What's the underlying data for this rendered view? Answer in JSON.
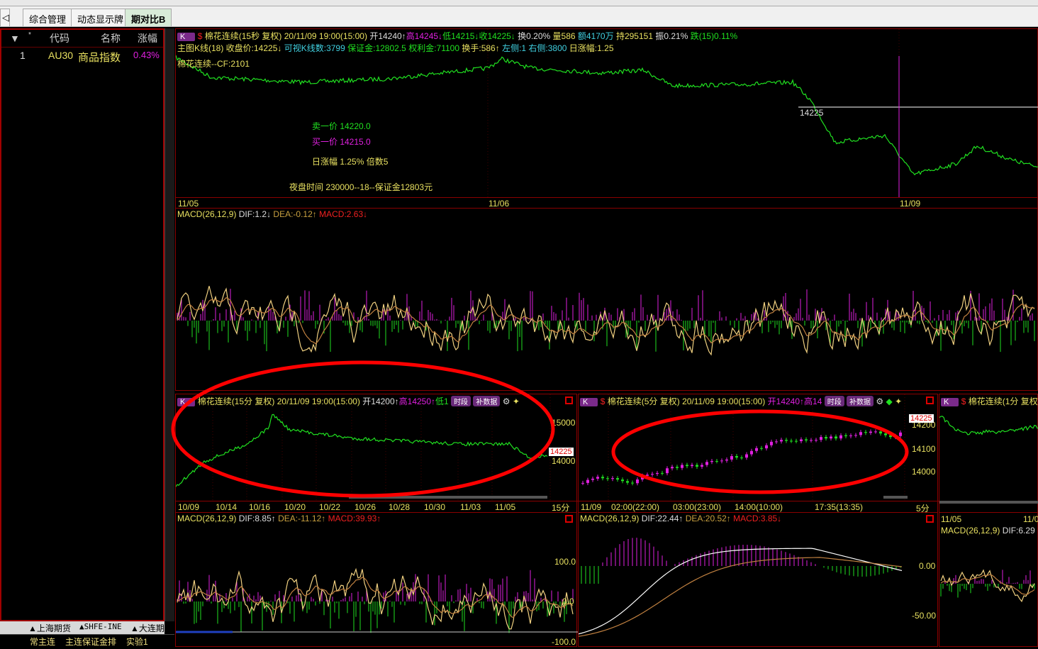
{
  "tabs": [
    "综合管理",
    "动态显示牌",
    "期对比B"
  ],
  "watchlist": {
    "headers": [
      "*",
      "代码",
      "名称",
      "涨幅"
    ],
    "rows": [
      {
        "no": "1",
        "code": "AU30",
        "name": "商品指数",
        "change": "0.43%"
      }
    ]
  },
  "main": {
    "k": "K",
    "title": "棉花连续(15秒 复权)",
    "time": "20/11/09 19:00(15:00)",
    "open": "开14240↑",
    "high": "高14245↓",
    "low": "低14215↓",
    "close": "收14225↓",
    "turn": "换0.20%",
    "vol": "量586",
    "amt": "额4170万",
    "hold": "持295151",
    "amp": "振0.21%",
    "fall": "跌(15)0.11%",
    "line2": {
      "a": "主图K线(18) 收盘价:14225↓",
      "b": "可视K线数:3799",
      "c": "保证金:12802.5",
      "d": "权利金:71100",
      "e": "换手:586↑",
      "f": "左侧:1",
      "g": "右侧:3800",
      "h": "日涨幅:1.25"
    },
    "contract": "棉花连续--CF:2101",
    "sell": "卖一价 14220.0",
    "buy": "买一价 14215.0",
    "daily": "日涨幅  1.25%  倍数5",
    "night": "夜盘时间 230000--18--保证金12803元",
    "cursor_price": "14225",
    "dates": [
      "11/05",
      "11/06",
      "11/09"
    ],
    "macd": {
      "label": "MACD(26,12,9)",
      "dif": "DIF:1.2↓",
      "dea": "DEA:-0.12↑",
      "macd": "MACD:2.63↓"
    }
  },
  "sub1": {
    "k": "K",
    "title": "棉花连续(15分 复权)",
    "time": "20/11/09 19:00(15:00)",
    "open": "开14200↑",
    "high": "高14250↑",
    "low": "低1",
    "btn1": "时段",
    "btn2": "补数据",
    "y": [
      "15000",
      "14000"
    ],
    "price": "14225",
    "dates": [
      "10/09",
      "10/14",
      "10/16",
      "10/20",
      "10/22",
      "10/26",
      "10/28",
      "10/30",
      "11/03",
      "11/05"
    ],
    "period": "15分",
    "macd": {
      "label": "MACD(26,12,9)",
      "dif": "DIF:8.85↑",
      "dea": "DEA:-11.12↑",
      "macd": "MACD:39.93↑",
      "y": [
        "100.0",
        "0.0",
        "-100.0"
      ]
    }
  },
  "sub2": {
    "k": "K",
    "title": "棉花连续(5分 复权)",
    "time": "20/11/09 19:00(15:00)",
    "open": "开14240↑",
    "high": "高14",
    "btn1": "时段",
    "btn2": "补数据",
    "y": [
      "14200",
      "14100",
      "14000"
    ],
    "price": "14225",
    "dates": [
      "11/09",
      "02:00(22:00)",
      "03:00(23:00)",
      "14:00(10:00)",
      "17:35(13:35)"
    ],
    "period": "5分",
    "macd": {
      "label": "MACD(26,12,9)",
      "dif": "DIF:22.44↑",
      "dea": "DEA:20.52↑",
      "macd": "MACD:3.85↓",
      "y": [
        "0.00",
        "-50.00"
      ]
    }
  },
  "sub3": {
    "k": "K",
    "title": "棉花连续(1分 复权)",
    "dates": [
      "11/05",
      "11/0"
    ],
    "macd": {
      "label": "MACD(26,12,9)",
      "dif": "DIF:6.29"
    }
  },
  "bottom": {
    "exchanges": [
      "▲上海期货",
      "▲SHFE-INE",
      "▲大连期"
    ],
    "groups": [
      "常主连",
      "主连保证金排",
      "实验1"
    ]
  }
}
